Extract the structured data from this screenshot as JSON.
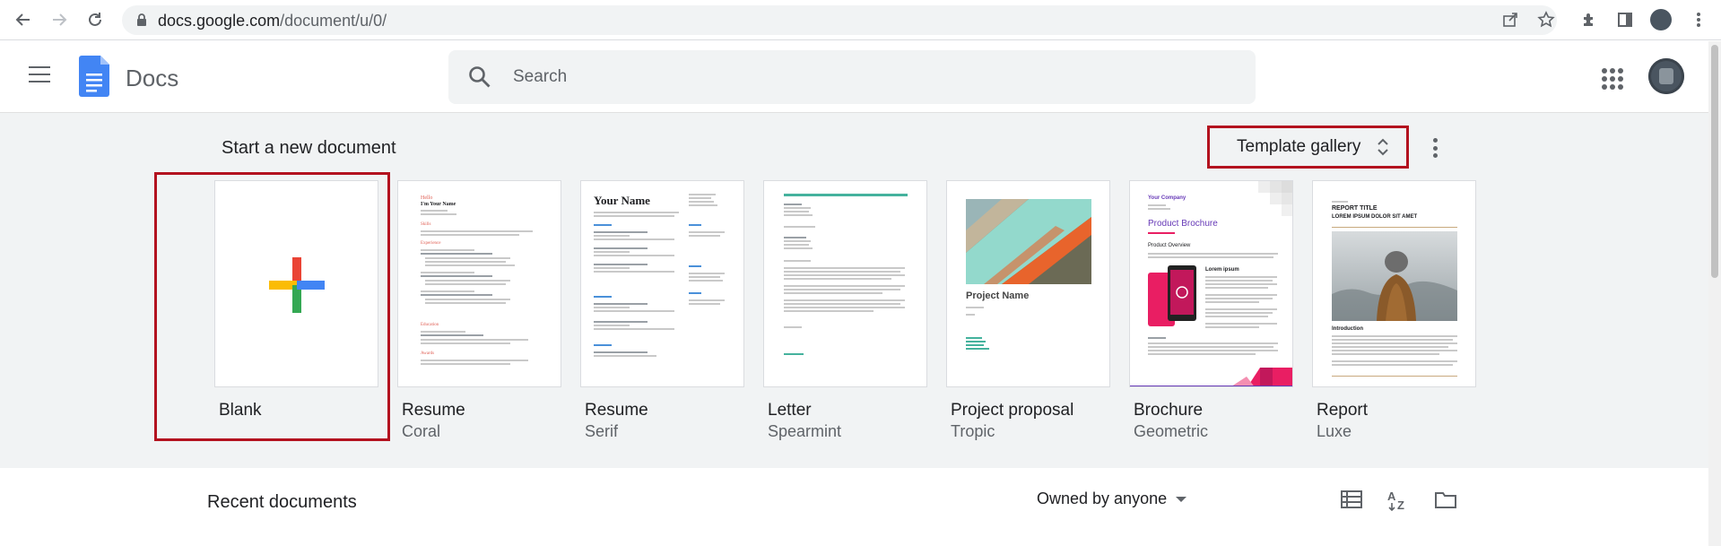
{
  "browser": {
    "url_host": "docs.google.com",
    "url_path": "/document/u/0/"
  },
  "header": {
    "app_name": "Docs",
    "search_placeholder": "Search"
  },
  "templates": {
    "section_title": "Start a new document",
    "gallery_label": "Template gallery",
    "items": [
      {
        "name": "Blank",
        "subtitle": ""
      },
      {
        "name": "Resume",
        "subtitle": "Coral"
      },
      {
        "name": "Resume",
        "subtitle": "Serif"
      },
      {
        "name": "Letter",
        "subtitle": "Spearmint"
      },
      {
        "name": "Project proposal",
        "subtitle": "Tropic"
      },
      {
        "name": "Brochure",
        "subtitle": "Geometric"
      },
      {
        "name": "Report",
        "subtitle": "Luxe"
      }
    ],
    "thumb_text": {
      "serif_name": "Your Name",
      "proposal_title": "Project Name",
      "brochure_company": "Your Company",
      "brochure_title": "Product Brochure",
      "brochure_section": "Product Overview",
      "brochure_lorem": "Lorem ipsum",
      "report_title": "REPORT TITLE",
      "report_subtitle": "LOREM IPSUM DOLOR SIT AMET",
      "report_intro": "Introduction",
      "coral_hello": "Hello",
      "coral_name": "I'm Your Name",
      "coral_skills": "Skills",
      "coral_experience": "Experience",
      "coral_education": "Education",
      "coral_awards": "Awards"
    }
  },
  "recent": {
    "title": "Recent documents",
    "owner_filter": "Owned by anyone"
  },
  "colors": {
    "docs_blue": "#4285f4",
    "highlight_red": "#b3121f",
    "section_bg": "#f1f3f4"
  }
}
